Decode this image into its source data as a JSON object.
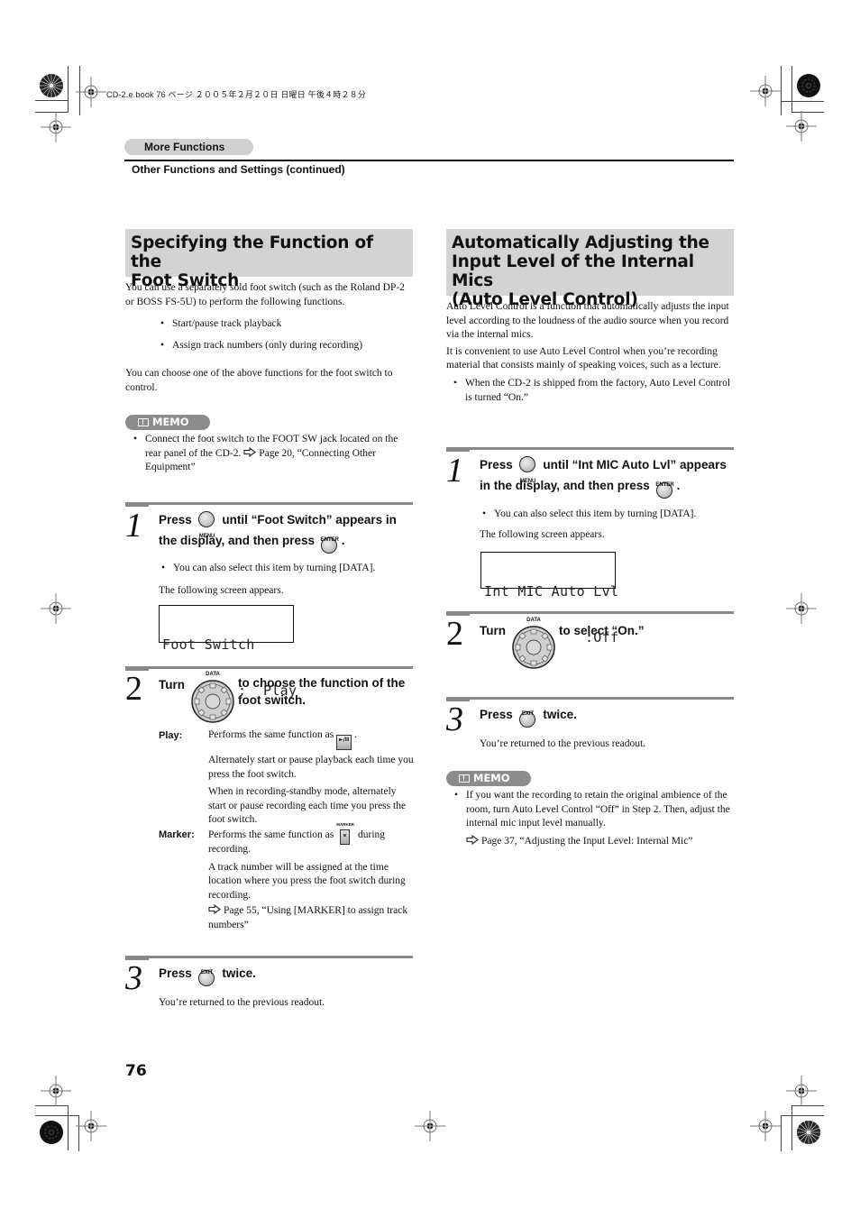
{
  "print_meta": "CD-2.e.book  76 ページ  ２００５年２月２０日  日曜日  午後４時２８分",
  "header": {
    "section": "More Functions",
    "subsection": "Other Functions and Settings (continued)"
  },
  "left": {
    "title_line1": "Specifying the Function of the",
    "title_line2": "Foot Switch",
    "intro": "You can use a separately sold foot switch (such as the Roland DP-2 or BOSS FS-5U) to perform the following functions.",
    "functions": [
      "Start/pause track playback",
      "Assign track numbers (only during recording)"
    ],
    "choose_text": "You can choose one of the above functions for the foot switch to control.",
    "memo": {
      "label": "MEMO",
      "text": "Connect the foot switch to the FOOT SW jack located on the rear panel of the CD-2.",
      "ref": "Page 20, “Connecting Other Equipment”"
    },
    "step1": {
      "number": "1",
      "press": "Press",
      "menu_label": "MENU",
      "text_a": "until “Foot Switch” appears in",
      "text_b": "the display, and then press",
      "enter_label": "ENTER",
      "period": ".",
      "note": "You can also select this item by turning [DATA].",
      "screen_intro": "The following screen appears.",
      "lcd_line1": "Foot Switch",
      "lcd_line2": "         :  Play"
    },
    "step2": {
      "number": "2",
      "turn": "Turn",
      "dial_label": "DATA",
      "text_a": "to choose the function of the",
      "text_b": "foot switch.",
      "terms": [
        {
          "term": "Play:",
          "paragraphs": [
            "Performs the same function as",
            "Alternately start or pause playback each time you press the foot switch.",
            "When in recording-standby mode, alternately start or pause recording each time you press the foot switch."
          ],
          "button_icon": "play-pause-button",
          "button_text": "►/II"
        },
        {
          "term": "Marker:",
          "paragraphs": [
            "Performs the same function as",
            "during recording.",
            "A track number will be assigned at the time location where you press the foot switch during recording."
          ],
          "button_icon": "marker-button",
          "button_label": "MARKER",
          "ref": "Page 55, “Using [MARKER] to assign track numbers”"
        }
      ]
    },
    "step3": {
      "number": "3",
      "press": "Press",
      "exit_label": "EXIT",
      "twice": "twice.",
      "result": "You’re returned to the previous readout."
    }
  },
  "right": {
    "title_line1": "Automatically Adjusting the",
    "title_line2": "Input Level of the Internal Mics",
    "title_line3": "(Auto Level Control)",
    "para1": "Auto Level Control is a function that automatically adjusts the input level according to the loudness of the audio source when you record via the internal mics.",
    "para2": "It is convenient to use Auto Level Control when you’re recording material that consists mainly of speaking voices, such as a lecture.",
    "bullet": "When the CD-2 is shipped from the factory, Auto Level Control is turned “On.”",
    "step1": {
      "number": "1",
      "press": "Press",
      "menu_label": "MENU",
      "text_a": "until “Int MIC Auto Lvl” appears",
      "text_b": "in the display, and then press",
      "enter_label": "ENTER",
      "period": ".",
      "note": "You can also select this item by turning [DATA].",
      "screen_intro": "The following screen appears.",
      "lcd_line1": "Int MIC Auto Lvl",
      "lcd_line2": "            :Off"
    },
    "step2": {
      "number": "2",
      "turn": "Turn",
      "dial_label": "DATA",
      "text": "to select “On.”"
    },
    "step3": {
      "number": "3",
      "press": "Press",
      "exit_label": "EXIT",
      "twice": "twice.",
      "result": "You’re returned to the previous readout."
    },
    "memo": {
      "label": "MEMO",
      "text": "If you want the recording to retain the original ambience of the room, turn Auto Level Control “Off” in Step 2. Then, adjust the internal mic input level manually.",
      "ref": "Page 37, “Adjusting the Input Level: Internal Mic”"
    }
  },
  "page_number": "76"
}
